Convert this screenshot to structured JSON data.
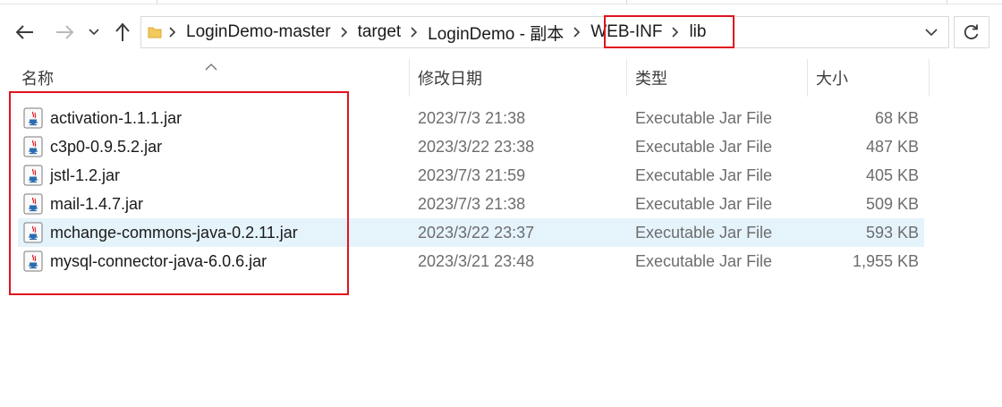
{
  "address_bar": {
    "breadcrumbs": [
      "LoginDemo-master",
      "target",
      "LoginDemo - 副本",
      "WEB-INF",
      "lib"
    ]
  },
  "columns": {
    "name": "名称",
    "date": "修改日期",
    "type": "类型",
    "size": "大小"
  },
  "files": [
    {
      "name": "activation-1.1.1.jar",
      "date": "2023/7/3 21:38",
      "type": "Executable Jar File",
      "size": "68 KB"
    },
    {
      "name": "c3p0-0.9.5.2.jar",
      "date": "2023/3/22 23:38",
      "type": "Executable Jar File",
      "size": "487 KB"
    },
    {
      "name": "jstl-1.2.jar",
      "date": "2023/7/3 21:59",
      "type": "Executable Jar File",
      "size": "405 KB"
    },
    {
      "name": "mail-1.4.7.jar",
      "date": "2023/7/3 21:38",
      "type": "Executable Jar File",
      "size": "509 KB"
    },
    {
      "name": "mchange-commons-java-0.2.11.jar",
      "date": "2023/3/22 23:37",
      "type": "Executable Jar File",
      "size": "593 KB",
      "hovered": true
    },
    {
      "name": "mysql-connector-java-6.0.6.jar",
      "date": "2023/3/21 23:48",
      "type": "Executable Jar File",
      "size": "1,955 KB"
    }
  ],
  "colors": {
    "highlight_box": "#e0141e",
    "hover_row": "#e5f3fb"
  }
}
